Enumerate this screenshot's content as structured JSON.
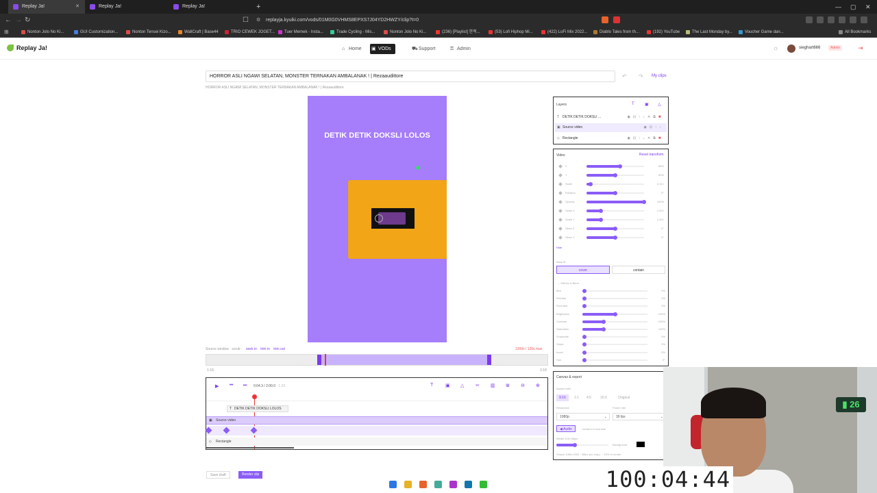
{
  "browser": {
    "tabs": [
      {
        "label": "Replay Ja!",
        "active": true
      },
      {
        "label": "Replay Ja!",
        "active": false
      },
      {
        "label": "Replay Ja!",
        "active": false
      }
    ],
    "url": "replayja.kyuiki.com/vods/01M0G0VHMS8EPXS7J04YD2HWZY/clip?t=0",
    "bookmarks": [
      "Nonton Jolo No Ki...",
      "GUI Customization...",
      "Nonton Tensei Kizo...",
      "WallCraft | Base44",
      "TRIO CEWEK JOGET...",
      "Tuer Memek - Insta...",
      "Trade Cycling - Mis...",
      "Nonton Jolo No Ki...",
      "(236) [Playlist] 한적...",
      "(53) Lofi Hiphop Mi...",
      "(422) LoFi Mix 2022...",
      "Diablo Tales from th...",
      "(192) YouTube",
      "The Last Monday by...",
      "Voucher Game dan..."
    ],
    "all_bookmarks": "All Bookmarks"
  },
  "app": {
    "brand": "Replay Ja!",
    "nav": [
      {
        "label": "Home",
        "icon": "home-icon",
        "active": false
      },
      {
        "label": "VODs",
        "icon": "video-icon",
        "active": true
      },
      {
        "label": "Support",
        "icon": "cart-icon",
        "active": false
      },
      {
        "label": "Admin",
        "icon": "key-icon",
        "active": false
      }
    ],
    "username": "sieghart666",
    "role_badge": "Admin"
  },
  "editor": {
    "title_value": "HORROR ASLI NGAWI SELATAN, MONSTER TERNAKAN AMBALANAK ! | Rezaaudittore",
    "subtitle": "HORROR ASLI NGAWI SELATAN, MONSTER TERNAKAN AMBALANAK ! | Rezaaudittore",
    "my_clips": "My clips",
    "overlay_text": "DETIK DETIK DOKSLI LOLOS",
    "source_window": {
      "label": "Source window",
      "hint": "· scrub ·",
      "links": [
        "seek in",
        "trim in",
        "trim out"
      ],
      "duration": "1200s / 120s max",
      "start": "1:18",
      "end": "3:18"
    },
    "timeline": {
      "time": "0:04.3 / 2:00.0",
      "time_extra": "· 1:23",
      "tracks": {
        "text": "DETIK DETIK DOKSLI LOLOS",
        "source": "Source video",
        "rect": "Rectangle"
      }
    },
    "footer": {
      "save_draft": "Save draft",
      "render": "Render clip"
    }
  },
  "layers": {
    "title": "Layers",
    "items": [
      {
        "name": "DETIK DETIK DOKSLI ...",
        "icon": "text-icon",
        "selected": false
      },
      {
        "name": "Source video",
        "icon": "video-icon",
        "selected": true
      },
      {
        "name": "Rectangle",
        "icon": "shape-icon",
        "selected": false
      }
    ]
  },
  "video_props": {
    "title": "Video",
    "reset": "Reset transform",
    "sliders": [
      {
        "label": "X",
        "value": 0.58,
        "display": "58%"
      },
      {
        "label": "Y",
        "value": 0.5,
        "display": "50%"
      },
      {
        "label": "Scale",
        "value": 0.07,
        "display": "0.32×"
      },
      {
        "label": "Rotation",
        "value": 0.5,
        "display": "0°"
      },
      {
        "label": "Opacity",
        "value": 1.0,
        "display": "100%"
      },
      {
        "label": "Scale X",
        "value": 0.25,
        "display": "1.00×"
      },
      {
        "label": "Scale Y",
        "value": 0.25,
        "display": "1.00×"
      },
      {
        "label": "Skew X",
        "value": 0.5,
        "display": "0°"
      },
      {
        "label": "Skew Y",
        "value": 0.5,
        "display": "0°"
      }
    ],
    "hide": "Hide",
    "base_fit_label": "Base fit",
    "base_fit": [
      "cover",
      "contain"
    ],
    "effects_label": "Effects & filters",
    "effects": [
      {
        "label": "Blur",
        "value": 0.0,
        "display": "0%"
      },
      {
        "label": "Pixelate",
        "value": 0.0,
        "display": "0%"
      },
      {
        "label": "Rounded",
        "value": 0.0,
        "display": "0%"
      },
      {
        "label": "Brightness",
        "value": 0.5,
        "display": "100%"
      },
      {
        "label": "Contrast",
        "value": 0.33,
        "display": "100%"
      },
      {
        "label": "Saturation",
        "value": 0.33,
        "display": "100%"
      },
      {
        "label": "Grayscale",
        "value": 0.0,
        "display": "0%"
      },
      {
        "label": "Sepia",
        "value": 0.0,
        "display": "0%"
      },
      {
        "label": "Invert",
        "value": 0.0,
        "display": "0%"
      },
      {
        "label": "Hue",
        "value": 0.0,
        "display": "0°"
      }
    ]
  },
  "export": {
    "title": "Canvas & export",
    "aspect_label": "Aspect ratio",
    "aspects": [
      {
        "label": "9:16",
        "on": true
      },
      {
        "label": "1:1",
        "on": false
      },
      {
        "label": "4:5",
        "on": false
      },
      {
        "label": "16:9",
        "on": false
      },
      {
        "label": "Original",
        "on": false
      }
    ],
    "resolution_label": "Resolution",
    "resolution": "1080p",
    "framerate_label": "Frame rate",
    "framerate": "30 fps",
    "audio": "Audio",
    "audio_hint": "renders in real time",
    "bitrate_label": "Bitrate 8.00 Mbps",
    "bitrate_value": 0.35,
    "background_label": "Background",
    "footer_note": "Output 1080×1920 · 30fps (no crop) · ~12% in render"
  },
  "overlay": {
    "timer": "100:04:44",
    "counter": "26"
  },
  "colors": {
    "accent": "#7c3aed",
    "canvas": "#a67dfa",
    "rect": "#f2a516"
  }
}
